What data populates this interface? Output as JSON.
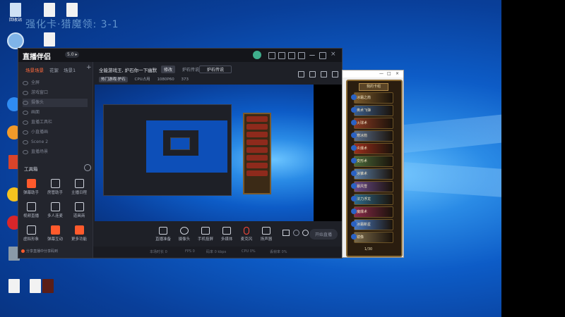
{
  "desktop": {
    "overlay_title": "强化卡·猎魔领: 3-1",
    "icons": [
      {
        "label": "回收站",
        "kind": "recycle"
      },
      {
        "label": "",
        "kind": "file"
      },
      {
        "label": "",
        "kind": "file"
      },
      {
        "label": "",
        "kind": "browser"
      },
      {
        "label": "",
        "kind": "file"
      },
      {
        "label": "",
        "kind": "app-blue"
      },
      {
        "label": "",
        "kind": "app-orange"
      },
      {
        "label": "",
        "kind": "app-red"
      },
      {
        "label": "",
        "kind": "app-yellow"
      },
      {
        "label": "",
        "kind": "app-red"
      },
      {
        "label": "",
        "kind": "app-gray"
      },
      {
        "label": "",
        "kind": "file"
      },
      {
        "label": "",
        "kind": "file"
      },
      {
        "label": "",
        "kind": "file"
      }
    ]
  },
  "app": {
    "name": "直播伴侣",
    "version_tag": "5.0 ▸",
    "left_tabs": [
      "场景场景",
      "花絮",
      "场景1"
    ],
    "scenes": [
      "全屏",
      "游戏窗口",
      "摄像头",
      "画面",
      "直播工具栏",
      "小直播画",
      "Scene 2",
      "直播场景"
    ],
    "tools_label": "工具箱",
    "tools": [
      {
        "label": "弹幕助手",
        "accent": true
      },
      {
        "label": "房管助手",
        "accent": false
      },
      {
        "label": "主播日程",
        "accent": false
      },
      {
        "label": "视频直播",
        "accent": false
      },
      {
        "label": "多人连麦",
        "accent": false
      },
      {
        "label": "道具商",
        "accent": false
      },
      {
        "label": "虚拟形象",
        "accent": false
      },
      {
        "label": "弹幕互动",
        "accent": true
      },
      {
        "label": "更多功能",
        "accent": true
      }
    ],
    "left_footer": "分享直播中分享码到",
    "stream_title": "全能游戏王, 炉石你一下幽默",
    "edit_button": "修改",
    "category": "炉石传说",
    "category_button": "炉石传说",
    "sub_info": [
      "热门游戏·炉石",
      "CPU占用",
      "1080P60",
      "373"
    ],
    "bottom_buttons": [
      {
        "label": "直播准备",
        "red": false
      },
      {
        "label": "摄像头",
        "red": false
      },
      {
        "label": "手机投屏",
        "red": false
      },
      {
        "label": "多媒体",
        "red": false
      },
      {
        "label": "麦克风",
        "red": true
      },
      {
        "label": "扬声器",
        "red": false
      }
    ],
    "live_button": "开始直播",
    "status": [
      "本场时长 0",
      "FPS 0",
      "码率 0 kbps",
      "CPU 0%",
      "丢帧率 0%"
    ]
  },
  "card_window": {
    "header": "我的卡组",
    "cards": [
      "冰霜之箭",
      "奥术飞弹",
      "火球术",
      "寒冰箭",
      "炎爆术",
      "变形术",
      "冰锥术",
      "暴风雪",
      "法力浮龙",
      "魔爆术",
      "冰霜新星",
      "镜像"
    ],
    "card_count": "1/30"
  }
}
